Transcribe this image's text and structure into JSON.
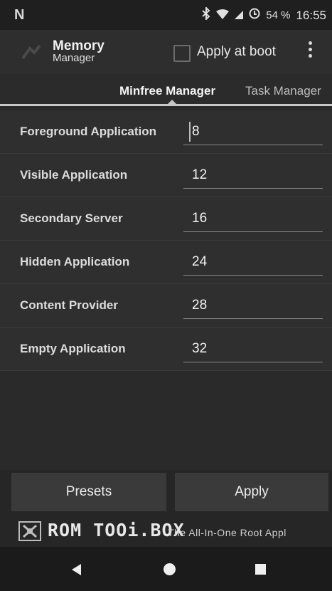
{
  "status_bar": {
    "left_icon": "N",
    "battery": "54 %",
    "time": "16:55",
    "icons": [
      "bluetooth-icon",
      "wifi-icon",
      "signal-icon",
      "battery-saver-icon"
    ]
  },
  "app_bar": {
    "title": "Memory",
    "subtitle": "Manager",
    "apply_at_boot_label": "Apply at boot",
    "apply_at_boot_checked": false
  },
  "tabs": [
    {
      "label": "Minfree Manager",
      "selected": true
    },
    {
      "label": "Task Manager",
      "selected": false
    }
  ],
  "rows": [
    {
      "label": "Foreground Application",
      "value": "8"
    },
    {
      "label": "Visible Application",
      "value": "12"
    },
    {
      "label": "Secondary Server",
      "value": "16"
    },
    {
      "label": "Hidden Application",
      "value": "24"
    },
    {
      "label": "Content Provider",
      "value": "28"
    },
    {
      "label": "Empty Application",
      "value": "32"
    }
  ],
  "buttons": {
    "presets": "Presets",
    "apply": "Apply"
  },
  "banner": {
    "brand": "ROM TOOi.BOX",
    "tagline": "The All-In-One Root Appl"
  },
  "colors": {
    "background": "#262626",
    "accent": "#c8c8c8"
  }
}
